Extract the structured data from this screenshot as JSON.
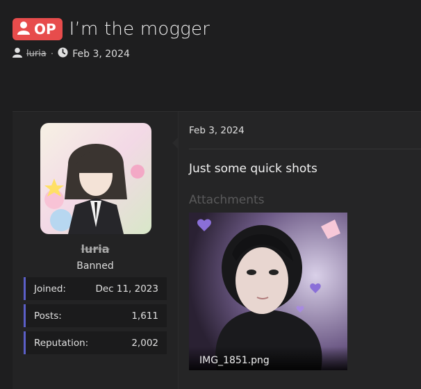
{
  "thread": {
    "badge": "OP",
    "title": "I’m the mogger",
    "author": "luria",
    "date": "Feb 3, 2024"
  },
  "sidebar": {
    "username": "luria",
    "user_title": "Banned",
    "stats": [
      {
        "label": "Joined:",
        "value": "Dec 11, 2023"
      },
      {
        "label": "Posts:",
        "value": "1,611"
      },
      {
        "label": "Reputation:",
        "value": "2,002"
      }
    ]
  },
  "post": {
    "date": "Feb 3, 2024",
    "text": "Just some quick shots",
    "attachments_label": "Attachments",
    "attachment_name": "IMG_1851.png"
  },
  "colors": {
    "badge_red": "#e74c4c",
    "stat_accent": "#5b5fc7",
    "background": "#1e1e1f"
  },
  "icons": {
    "badge": "user-icon",
    "author": "user-icon",
    "date": "clock-icon"
  }
}
